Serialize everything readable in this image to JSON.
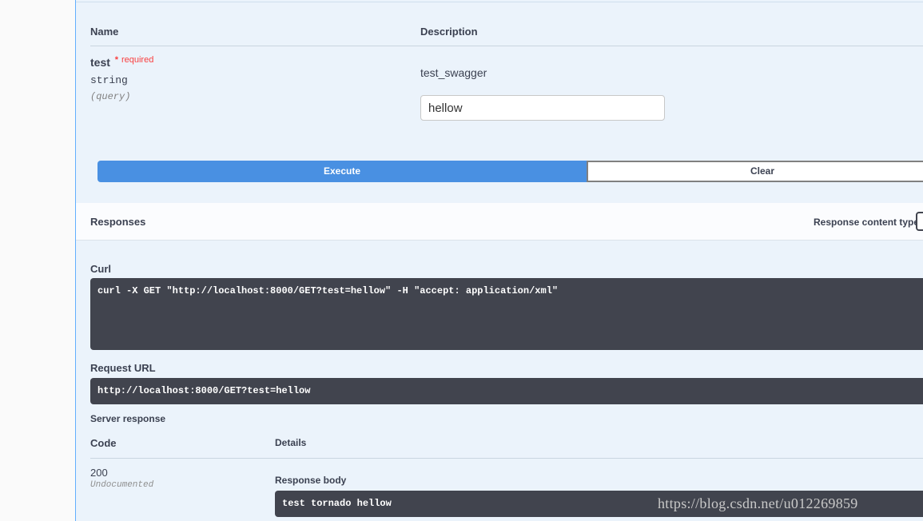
{
  "params": {
    "headers": {
      "name": "Name",
      "description": "Description"
    },
    "items": [
      {
        "name": "test",
        "required_star": "*",
        "required_label": "required",
        "type": "string",
        "location": "(query)",
        "description": "test_swagger",
        "value": "hellow"
      }
    ]
  },
  "actions": {
    "execute": "Execute",
    "clear": "Clear"
  },
  "responses": {
    "title": "Responses",
    "content_type_label": "Response content type"
  },
  "curl": {
    "title": "Curl",
    "command": "curl -X GET \"http://localhost:8000/GET?test=hellow\" -H \"accept: application/xml\""
  },
  "request_url": {
    "title": "Request URL",
    "url": "http://localhost:8000/GET?test=hellow"
  },
  "server_response": {
    "title": "Server response",
    "headers": {
      "code": "Code",
      "details": "Details"
    },
    "code": "200",
    "status": "Undocumented",
    "body_title": "Response body",
    "body": "test tornado hellow"
  },
  "watermark": "https://blog.csdn.net/u012269859",
  "colors": {
    "panel_bg": "#ebf3fb",
    "execute_button": "#4990e2",
    "code_block": "#41444e",
    "required": "#f93e3e"
  }
}
